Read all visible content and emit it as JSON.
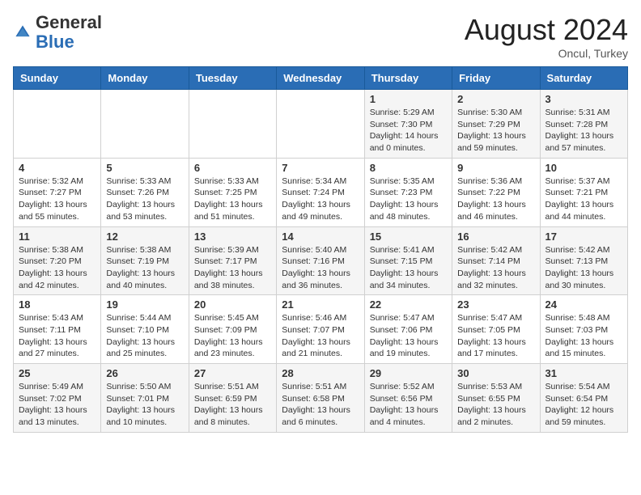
{
  "header": {
    "logo_general": "General",
    "logo_blue": "Blue",
    "month_year": "August 2024",
    "location": "Oncul, Turkey"
  },
  "weekdays": [
    "Sunday",
    "Monday",
    "Tuesday",
    "Wednesday",
    "Thursday",
    "Friday",
    "Saturday"
  ],
  "weeks": [
    [
      {
        "day": "",
        "info": ""
      },
      {
        "day": "",
        "info": ""
      },
      {
        "day": "",
        "info": ""
      },
      {
        "day": "",
        "info": ""
      },
      {
        "day": "1",
        "info": "Sunrise: 5:29 AM\nSunset: 7:30 PM\nDaylight: 14 hours\nand 0 minutes."
      },
      {
        "day": "2",
        "info": "Sunrise: 5:30 AM\nSunset: 7:29 PM\nDaylight: 13 hours\nand 59 minutes."
      },
      {
        "day": "3",
        "info": "Sunrise: 5:31 AM\nSunset: 7:28 PM\nDaylight: 13 hours\nand 57 minutes."
      }
    ],
    [
      {
        "day": "4",
        "info": "Sunrise: 5:32 AM\nSunset: 7:27 PM\nDaylight: 13 hours\nand 55 minutes."
      },
      {
        "day": "5",
        "info": "Sunrise: 5:33 AM\nSunset: 7:26 PM\nDaylight: 13 hours\nand 53 minutes."
      },
      {
        "day": "6",
        "info": "Sunrise: 5:33 AM\nSunset: 7:25 PM\nDaylight: 13 hours\nand 51 minutes."
      },
      {
        "day": "7",
        "info": "Sunrise: 5:34 AM\nSunset: 7:24 PM\nDaylight: 13 hours\nand 49 minutes."
      },
      {
        "day": "8",
        "info": "Sunrise: 5:35 AM\nSunset: 7:23 PM\nDaylight: 13 hours\nand 48 minutes."
      },
      {
        "day": "9",
        "info": "Sunrise: 5:36 AM\nSunset: 7:22 PM\nDaylight: 13 hours\nand 46 minutes."
      },
      {
        "day": "10",
        "info": "Sunrise: 5:37 AM\nSunset: 7:21 PM\nDaylight: 13 hours\nand 44 minutes."
      }
    ],
    [
      {
        "day": "11",
        "info": "Sunrise: 5:38 AM\nSunset: 7:20 PM\nDaylight: 13 hours\nand 42 minutes."
      },
      {
        "day": "12",
        "info": "Sunrise: 5:38 AM\nSunset: 7:19 PM\nDaylight: 13 hours\nand 40 minutes."
      },
      {
        "day": "13",
        "info": "Sunrise: 5:39 AM\nSunset: 7:17 PM\nDaylight: 13 hours\nand 38 minutes."
      },
      {
        "day": "14",
        "info": "Sunrise: 5:40 AM\nSunset: 7:16 PM\nDaylight: 13 hours\nand 36 minutes."
      },
      {
        "day": "15",
        "info": "Sunrise: 5:41 AM\nSunset: 7:15 PM\nDaylight: 13 hours\nand 34 minutes."
      },
      {
        "day": "16",
        "info": "Sunrise: 5:42 AM\nSunset: 7:14 PM\nDaylight: 13 hours\nand 32 minutes."
      },
      {
        "day": "17",
        "info": "Sunrise: 5:42 AM\nSunset: 7:13 PM\nDaylight: 13 hours\nand 30 minutes."
      }
    ],
    [
      {
        "day": "18",
        "info": "Sunrise: 5:43 AM\nSunset: 7:11 PM\nDaylight: 13 hours\nand 27 minutes."
      },
      {
        "day": "19",
        "info": "Sunrise: 5:44 AM\nSunset: 7:10 PM\nDaylight: 13 hours\nand 25 minutes."
      },
      {
        "day": "20",
        "info": "Sunrise: 5:45 AM\nSunset: 7:09 PM\nDaylight: 13 hours\nand 23 minutes."
      },
      {
        "day": "21",
        "info": "Sunrise: 5:46 AM\nSunset: 7:07 PM\nDaylight: 13 hours\nand 21 minutes."
      },
      {
        "day": "22",
        "info": "Sunrise: 5:47 AM\nSunset: 7:06 PM\nDaylight: 13 hours\nand 19 minutes."
      },
      {
        "day": "23",
        "info": "Sunrise: 5:47 AM\nSunset: 7:05 PM\nDaylight: 13 hours\nand 17 minutes."
      },
      {
        "day": "24",
        "info": "Sunrise: 5:48 AM\nSunset: 7:03 PM\nDaylight: 13 hours\nand 15 minutes."
      }
    ],
    [
      {
        "day": "25",
        "info": "Sunrise: 5:49 AM\nSunset: 7:02 PM\nDaylight: 13 hours\nand 13 minutes."
      },
      {
        "day": "26",
        "info": "Sunrise: 5:50 AM\nSunset: 7:01 PM\nDaylight: 13 hours\nand 10 minutes."
      },
      {
        "day": "27",
        "info": "Sunrise: 5:51 AM\nSunset: 6:59 PM\nDaylight: 13 hours\nand 8 minutes."
      },
      {
        "day": "28",
        "info": "Sunrise: 5:51 AM\nSunset: 6:58 PM\nDaylight: 13 hours\nand 6 minutes."
      },
      {
        "day": "29",
        "info": "Sunrise: 5:52 AM\nSunset: 6:56 PM\nDaylight: 13 hours\nand 4 minutes."
      },
      {
        "day": "30",
        "info": "Sunrise: 5:53 AM\nSunset: 6:55 PM\nDaylight: 13 hours\nand 2 minutes."
      },
      {
        "day": "31",
        "info": "Sunrise: 5:54 AM\nSunset: 6:54 PM\nDaylight: 12 hours\nand 59 minutes."
      }
    ]
  ]
}
